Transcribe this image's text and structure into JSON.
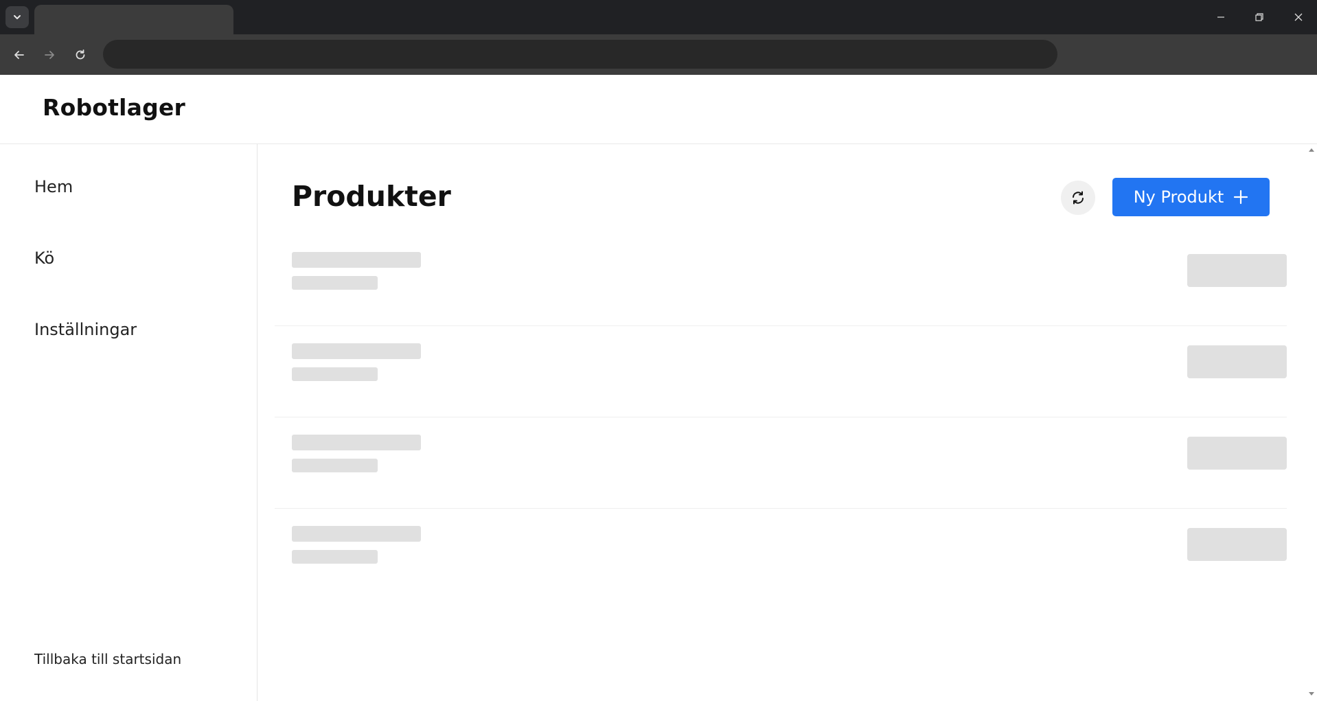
{
  "browser": {
    "tab_title": "",
    "address": ""
  },
  "app": {
    "brand": "Robotlager"
  },
  "sidebar": {
    "items": [
      {
        "label": "Hem"
      },
      {
        "label": "Kö"
      },
      {
        "label": "Inställningar"
      }
    ],
    "back_link": "Tillbaka till startsidan"
  },
  "main": {
    "title": "Produkter",
    "new_button_label": "Ny Produkt",
    "skeleton_rows": 4
  },
  "colors": {
    "accent": "#2275f2",
    "skeleton": "#e0e0e0"
  }
}
